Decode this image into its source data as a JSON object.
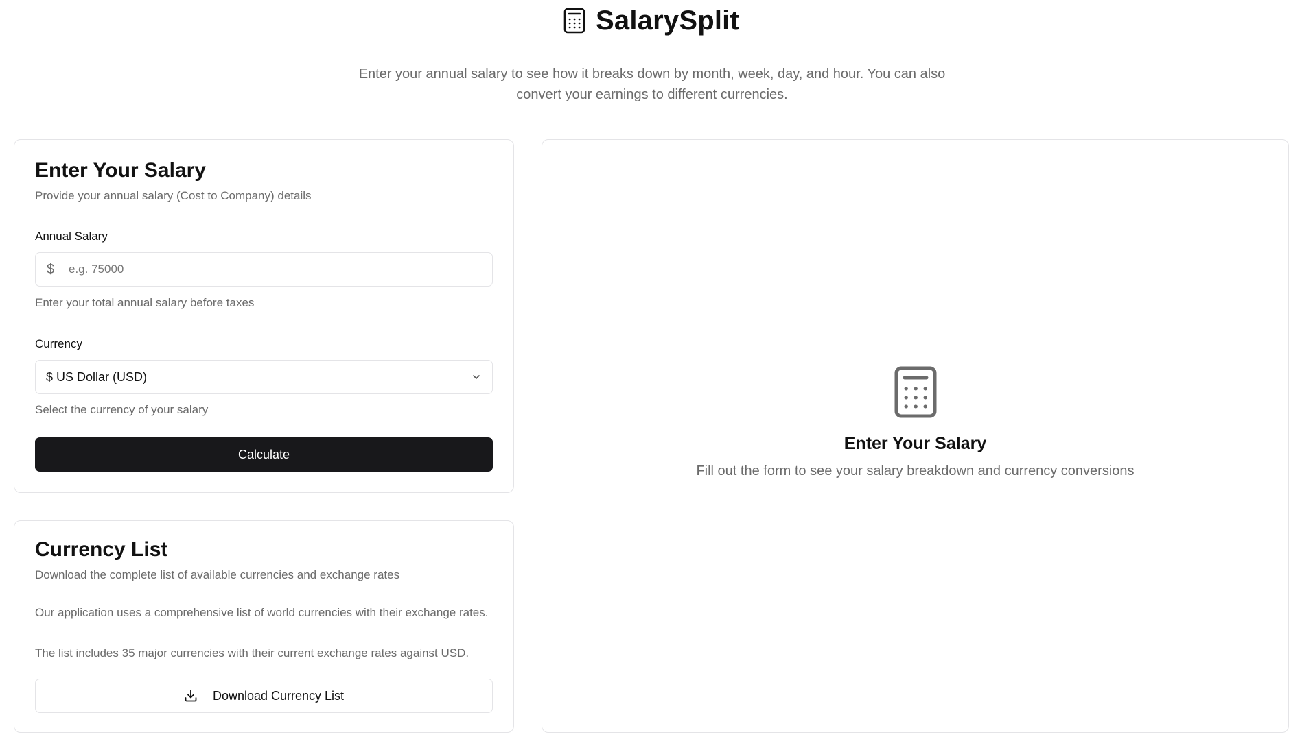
{
  "app": {
    "title": "SalarySplit",
    "logo_icon": "calculator-icon"
  },
  "intro": {
    "text": "Enter your annual salary to see how it breaks down by month, week, day, and hour. You can also convert your earnings to different currencies."
  },
  "salary_form": {
    "title": "Enter Your Salary",
    "description": "Provide your annual salary (Cost to Company) details",
    "annual_salary_label": "Annual Salary",
    "currency_prefix": "$",
    "annual_salary_placeholder": "e.g. 75000",
    "annual_salary_value": "",
    "annual_salary_hint": "Enter your total annual salary before taxes",
    "currency_label": "Currency",
    "currency_selected": "$ US Dollar (USD)",
    "currency_hint": "Select the currency of your salary",
    "calculate_label": "Calculate"
  },
  "currency_list": {
    "title": "Currency List",
    "description": "Download the complete list of available currencies and exchange rates",
    "paragraph_1": "Our application uses a comprehensive list of world currencies with their exchange rates.",
    "paragraph_2": "The list includes 35 major currencies with their current exchange rates against USD.",
    "download_label": "Download Currency List",
    "download_icon": "download-icon"
  },
  "result_panel": {
    "icon": "calculator-icon",
    "title": "Enter Your Salary",
    "text": "Fill out the form to see your salary breakdown and currency conversions"
  },
  "colors": {
    "primary_button": "#18181b",
    "border": "#e4e4e7",
    "muted_text": "#6b6b6b",
    "empty_icon": "#6b6b6b"
  }
}
